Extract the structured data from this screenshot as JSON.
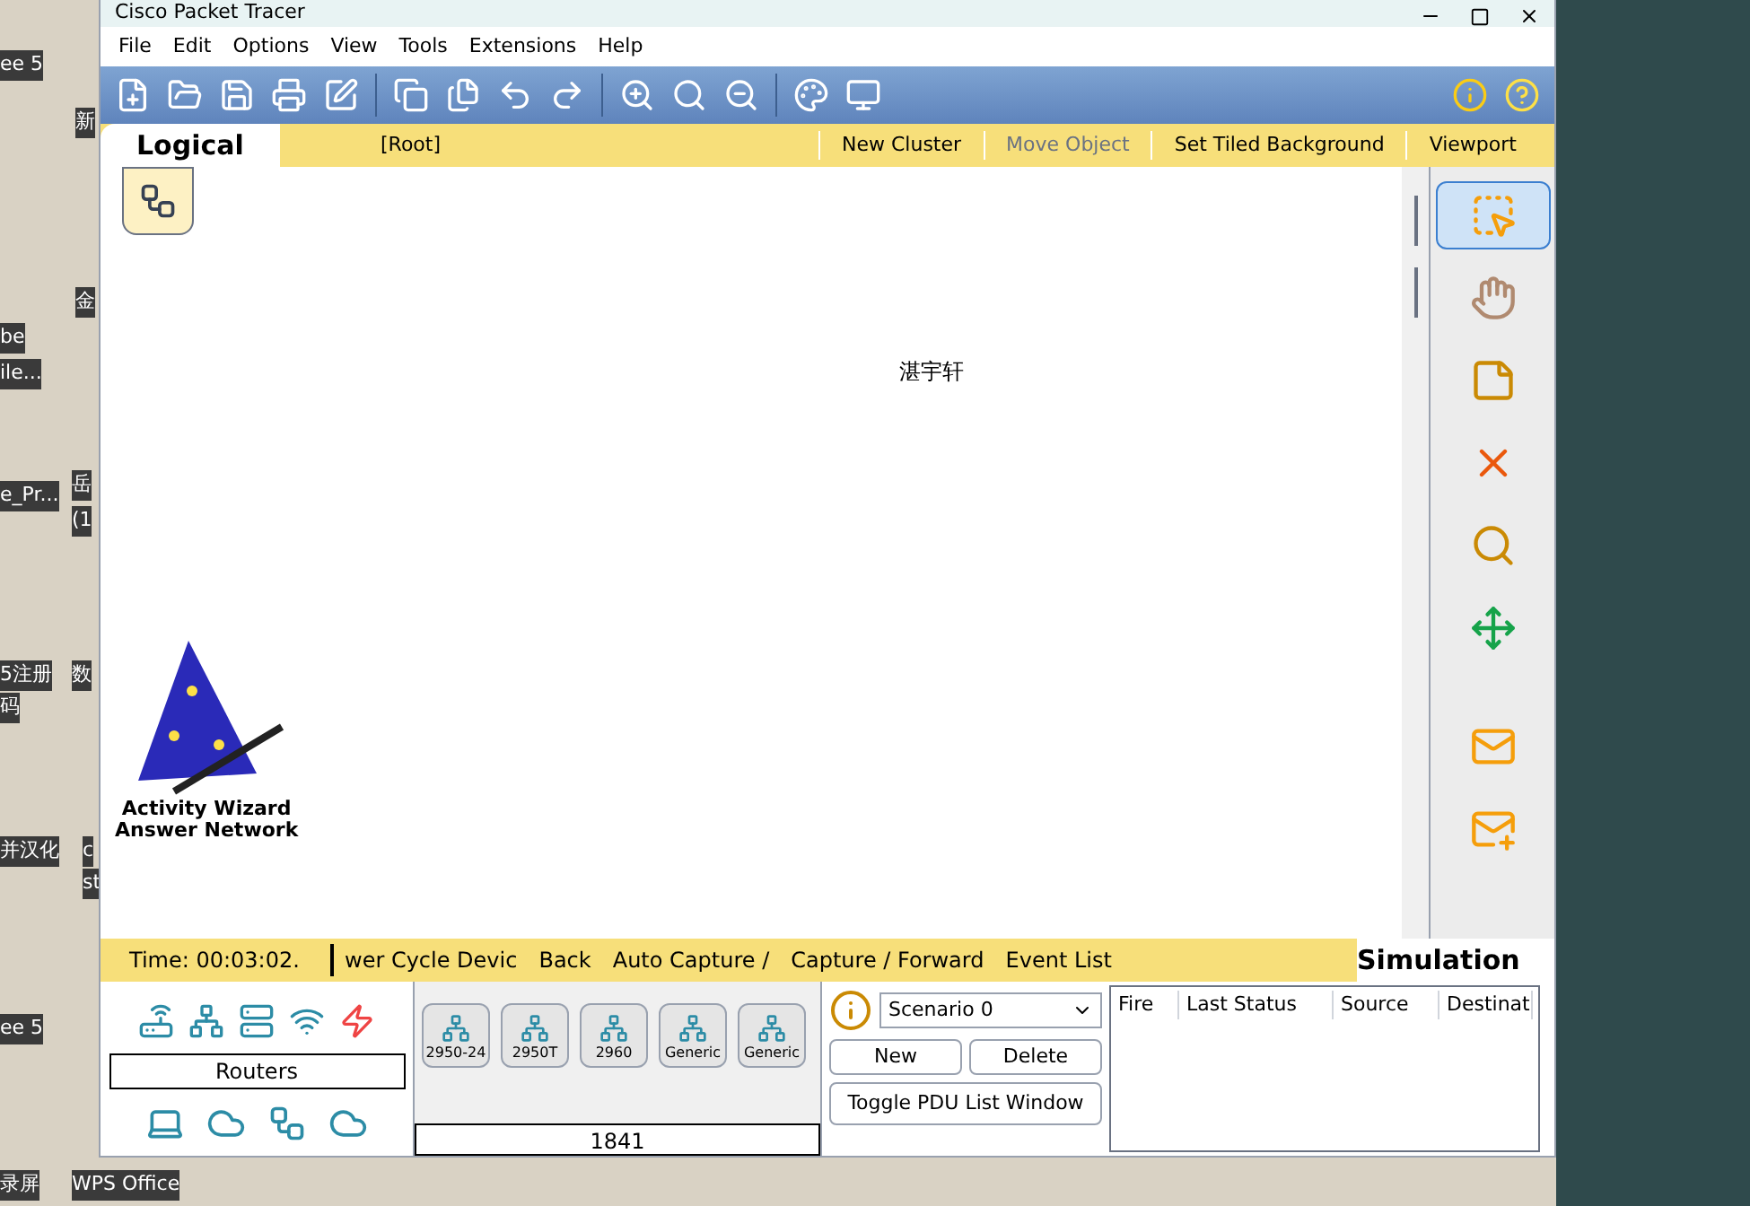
{
  "desktop_icons": [
    {
      "label": "ee 5"
    },
    {
      "label": "新"
    },
    {
      "label": "金"
    },
    {
      "label": "be"
    },
    {
      "label": "ile..."
    },
    {
      "label": "岳"
    },
    {
      "label": "e_Pr..."
    },
    {
      "label": "(1"
    },
    {
      "label": "5注册"
    },
    {
      "label": "数"
    },
    {
      "label": "码"
    },
    {
      "label": "并汉化"
    },
    {
      "label": "c"
    },
    {
      "label": "st"
    },
    {
      "label": "ee 5"
    },
    {
      "label": "录屏"
    },
    {
      "label": "WPS Office"
    }
  ],
  "window": {
    "title": "Cisco Packet Tracer"
  },
  "menu": [
    "File",
    "Edit",
    "Options",
    "View",
    "Tools",
    "Extensions",
    "Help"
  ],
  "logical_bar": {
    "tab": {
      "label": "Logical",
      "selected": true
    },
    "path": "[Root]",
    "actions": [
      {
        "label": "New Cluster",
        "disabled": false
      },
      {
        "label": "Move Object",
        "disabled": true
      },
      {
        "label": "Set Tiled Background",
        "disabled": false
      },
      {
        "label": "Viewport",
        "disabled": false
      }
    ]
  },
  "canvas": {
    "label": "湛宇轩",
    "wizard": [
      "Activity Wizard",
      "Answer Network"
    ]
  },
  "palette": [
    {
      "kind": "select",
      "selected": true
    },
    {
      "kind": "move",
      "selected": false
    },
    {
      "kind": "note",
      "selected": false
    },
    {
      "kind": "delete",
      "selected": false
    },
    {
      "kind": "inspect",
      "selected": false
    },
    {
      "kind": "resize",
      "selected": false
    },
    {
      "kind": "simple-pdu",
      "selected": false
    },
    {
      "kind": "complex-pdu",
      "selected": false
    }
  ],
  "sim_bar": {
    "time": "Time: 00:03:02.",
    "items": [
      "wer Cycle Devic",
      "Back",
      "Auto Capture /",
      "Capture / Forward",
      "Event List"
    ],
    "mode": {
      "label": "Simulation",
      "selected": true
    }
  },
  "devices": {
    "category": "Routers",
    "models": [
      "2950-24",
      "2950T",
      "2960",
      "Generic",
      "Generic"
    ],
    "model_name": "1841"
  },
  "scenario": {
    "value": "Scenario 0",
    "buttons": [
      "New",
      "Delete",
      "Toggle PDU List Window"
    ]
  },
  "pdu_table": {
    "columns": [
      "Fire",
      "Last Status",
      "Source",
      "Destinat"
    ]
  }
}
